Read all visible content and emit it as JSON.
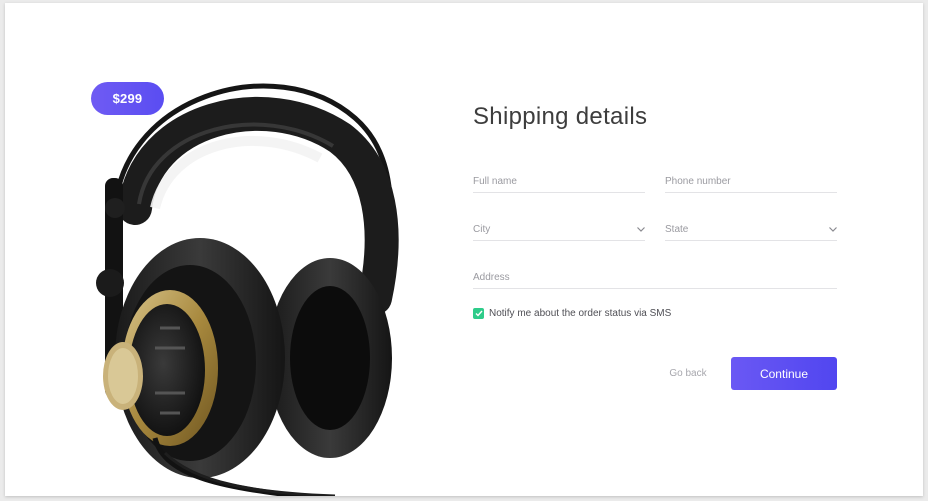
{
  "product": {
    "price": "$299",
    "image": "headphones-photo"
  },
  "form": {
    "title": "Shipping details",
    "fields": {
      "full_name": {
        "placeholder": "Full name"
      },
      "phone": {
        "placeholder": "Phone number"
      },
      "city": {
        "placeholder": "City",
        "icon": "chevron-down-icon"
      },
      "state": {
        "placeholder": "State",
        "icon": "chevron-down-icon"
      },
      "address": {
        "placeholder": "Address"
      }
    },
    "notify": {
      "label": "Notify me about the order status via SMS",
      "checked": true,
      "color": "#2ecc8a"
    }
  },
  "actions": {
    "back_label": "Go back",
    "continue_label": "Continue",
    "accent": "#5a4df2"
  }
}
